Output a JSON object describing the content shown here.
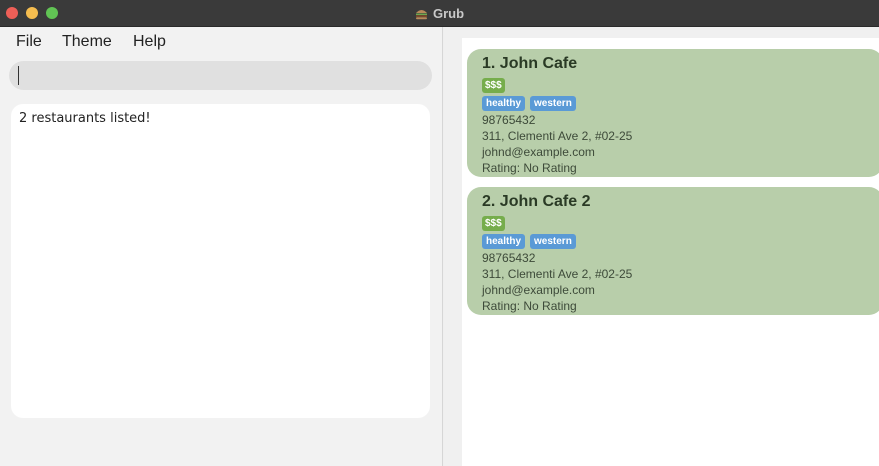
{
  "window": {
    "title": "Grub"
  },
  "menu": {
    "file": "File",
    "theme": "Theme",
    "help": "Help"
  },
  "command": {
    "value": ""
  },
  "result": {
    "text": "2 restaurants listed!"
  },
  "restaurants": [
    {
      "name": "1. John Cafe",
      "price": "$$$",
      "tags": [
        "healthy",
        "western"
      ],
      "phone": "98765432",
      "address": "311, Clementi Ave 2, #02-25",
      "email": "johnd@example.com",
      "rating": "Rating: No Rating"
    },
    {
      "name": "2. John Cafe 2",
      "price": "$$$",
      "tags": [
        "healthy",
        "western"
      ],
      "phone": "98765432",
      "address": "311, Clementi Ave 2, #02-25",
      "email": "johnd@example.com",
      "rating": "Rating: No Rating"
    }
  ],
  "colors": {
    "card_bg": "#b8ceaa",
    "price_tag": "#76ad4c",
    "tag": "#5a9ad6"
  },
  "icons": {
    "app": "burger-icon"
  }
}
